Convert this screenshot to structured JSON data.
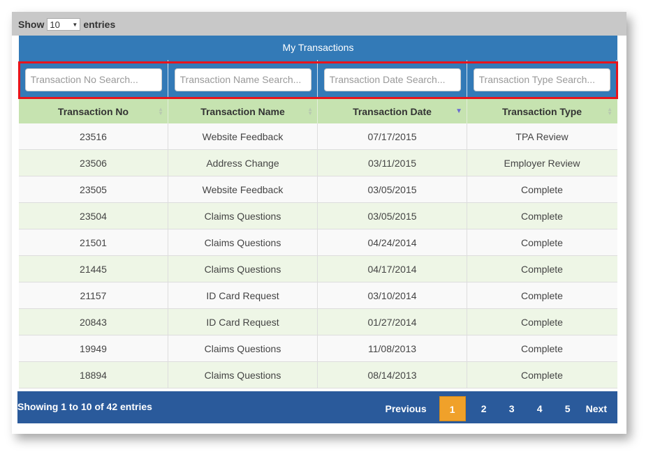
{
  "length_menu": {
    "prefix": "Show",
    "selected": "10",
    "suffix": "entries"
  },
  "table": {
    "title": "My Transactions",
    "search": [
      {
        "placeholder": "Transaction No Search..."
      },
      {
        "placeholder": "Transaction Name Search..."
      },
      {
        "placeholder": "Transaction Date Search..."
      },
      {
        "placeholder": "Transaction Type Search..."
      }
    ],
    "columns": [
      "Transaction No",
      "Transaction Name",
      "Transaction Date",
      "Transaction Type"
    ],
    "sorted_column": "Transaction Date",
    "sort_direction": "descending",
    "rows": [
      [
        "23516",
        "Website Feedback",
        "07/17/2015",
        "TPA Review"
      ],
      [
        "23506",
        "Address Change",
        "03/11/2015",
        "Employer Review"
      ],
      [
        "23505",
        "Website Feedback",
        "03/05/2015",
        "Complete"
      ],
      [
        "23504",
        "Claims Questions",
        "03/05/2015",
        "Complete"
      ],
      [
        "21501",
        "Claims Questions",
        "04/24/2014",
        "Complete"
      ],
      [
        "21445",
        "Claims Questions",
        "04/17/2014",
        "Complete"
      ],
      [
        "21157",
        "ID Card Request",
        "03/10/2014",
        "Complete"
      ],
      [
        "20843",
        "ID Card Request",
        "01/27/2014",
        "Complete"
      ],
      [
        "19949",
        "Claims Questions",
        "11/08/2013",
        "Complete"
      ],
      [
        "18894",
        "Claims Questions",
        "08/14/2013",
        "Complete"
      ]
    ]
  },
  "footer": {
    "info": "Showing 1 to 10 of 42 entries",
    "previous": "Previous",
    "pages": [
      "1",
      "2",
      "3",
      "4",
      "5"
    ],
    "current_page": "1",
    "next": "Next"
  },
  "colors": {
    "header_blue": "#337ab7",
    "column_header_green": "#c6e3b0",
    "footer_blue": "#2a5a9b",
    "active_page": "#f0a12a",
    "highlight_red": "#e8141b"
  }
}
